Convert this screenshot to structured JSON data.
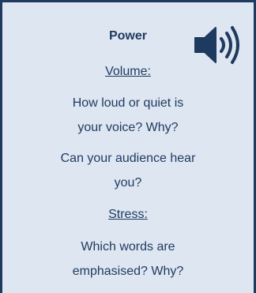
{
  "card": {
    "title": "Power",
    "icon": "speaker-volume-icon",
    "volume": {
      "heading": "Volume:",
      "q1_line1": "How loud or quiet is",
      "q1_line2": "your voice? Why?",
      "q2_line1": "Can your audience hear",
      "q2_line2": "you?"
    },
    "stress": {
      "heading": "Stress:",
      "q1_line1": "Which words are",
      "q1_line2": "emphasised? Why?"
    }
  }
}
